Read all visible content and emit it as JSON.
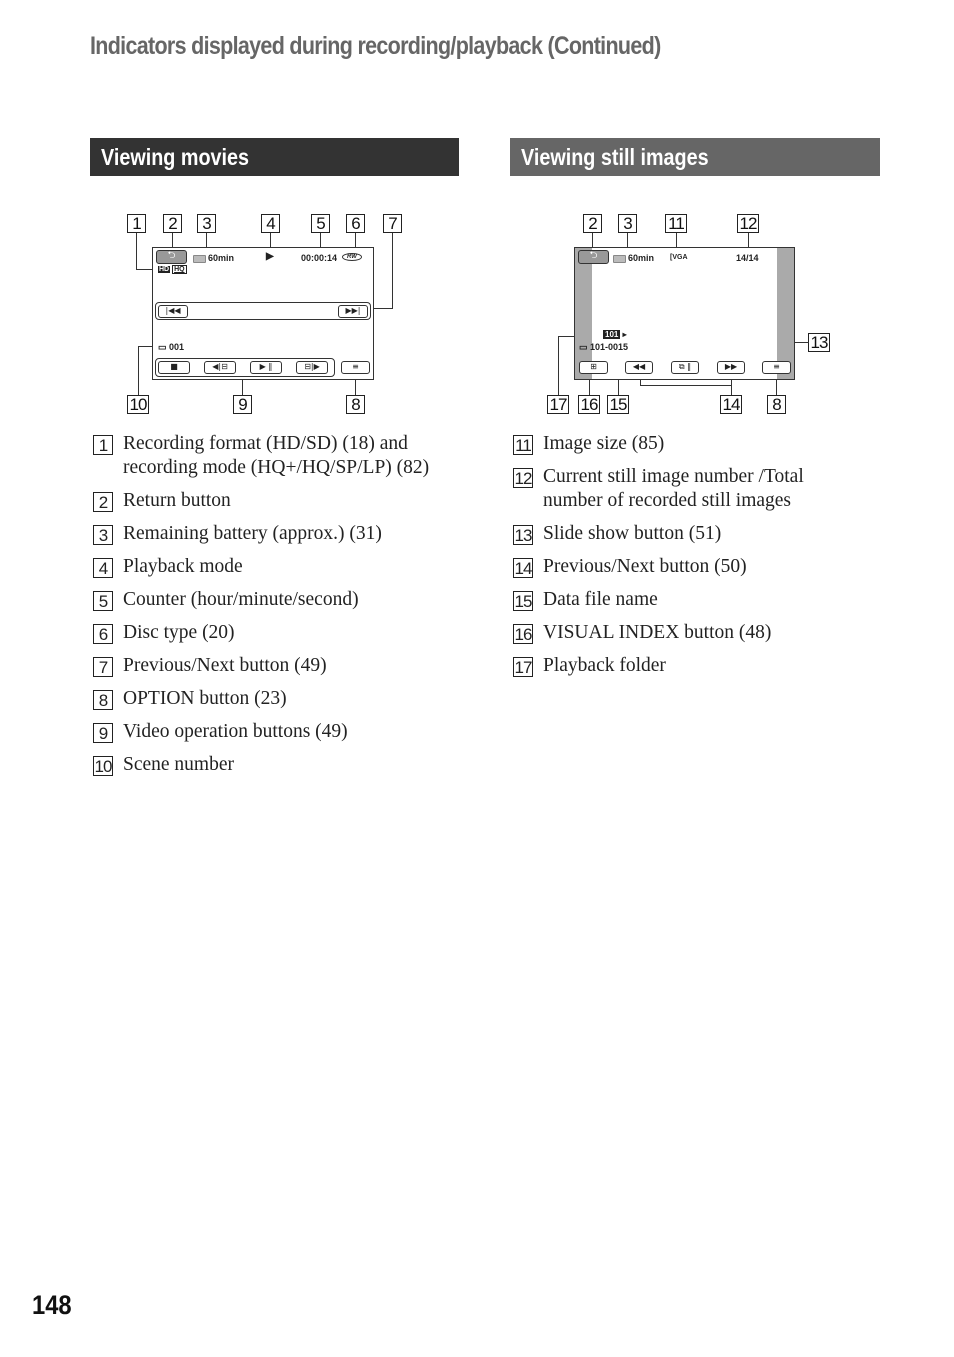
{
  "page": {
    "title": "Indicators displayed during recording/playback (Continued)",
    "page_number": "148"
  },
  "movies": {
    "heading": "Viewing movies",
    "screen": {
      "return_icon": "⮌",
      "battery_time": "60min",
      "playback_mode_icon": "▶",
      "counter": "00:00:14",
      "disc_type": "RW",
      "format_badges": [
        "HD",
        "HQ"
      ],
      "prev_icon": "|◀◀",
      "next_icon": "▶▶|",
      "scene_number": "001",
      "controls": [
        "■",
        "◀|⊟",
        "▶ ‖",
        "⊟|▶"
      ],
      "option_icon": "≡"
    },
    "callouts_top": [
      "1",
      "2",
      "3",
      "4",
      "5",
      "6",
      "7"
    ],
    "callouts_bottom": [
      "10",
      "9",
      "8"
    ],
    "legend": [
      {
        "num": "1",
        "text": "Recording format (HD/SD) (18) and recording mode (HQ+/HQ/SP/LP) (82)"
      },
      {
        "num": "2",
        "text": "Return button"
      },
      {
        "num": "3",
        "text": "Remaining battery (approx.) (31)"
      },
      {
        "num": "4",
        "text": "Playback mode"
      },
      {
        "num": "5",
        "text": "Counter (hour/minute/second)"
      },
      {
        "num": "6",
        "text": "Disc type (20)"
      },
      {
        "num": "7",
        "text": "Previous/Next button (49)"
      },
      {
        "num": "8",
        "text": "OPTION button (23)"
      },
      {
        "num": "9",
        "text": "Video operation buttons (49)"
      },
      {
        "num": "10",
        "text": "Scene number"
      }
    ]
  },
  "still": {
    "heading": "Viewing still images",
    "screen": {
      "return_icon": "⮌",
      "battery_time": "60min",
      "image_size": "VGA",
      "image_counter": "14/14",
      "folder": "101",
      "file_name": "101-0015",
      "index_icon": "⊞",
      "prev_icon": "◀◀",
      "slideshow_icon": "⧉ ‖",
      "next_icon": "▶▶",
      "option_icon": "≡"
    },
    "callouts_top": [
      "2",
      "3",
      "11",
      "12"
    ],
    "callout_side": "13",
    "callouts_bottom": [
      "17",
      "16",
      "15",
      "14",
      "8"
    ],
    "legend": [
      {
        "num": "11",
        "text": "Image size (85)"
      },
      {
        "num": "12",
        "text": "Current still image number /Total number of recorded still images"
      },
      {
        "num": "13",
        "text": "Slide show button (51)"
      },
      {
        "num": "14",
        "text": "Previous/Next button (50)"
      },
      {
        "num": "15",
        "text": "Data file name"
      },
      {
        "num": "16",
        "text": "VISUAL INDEX button (48)"
      },
      {
        "num": "17",
        "text": "Playback folder"
      }
    ]
  }
}
